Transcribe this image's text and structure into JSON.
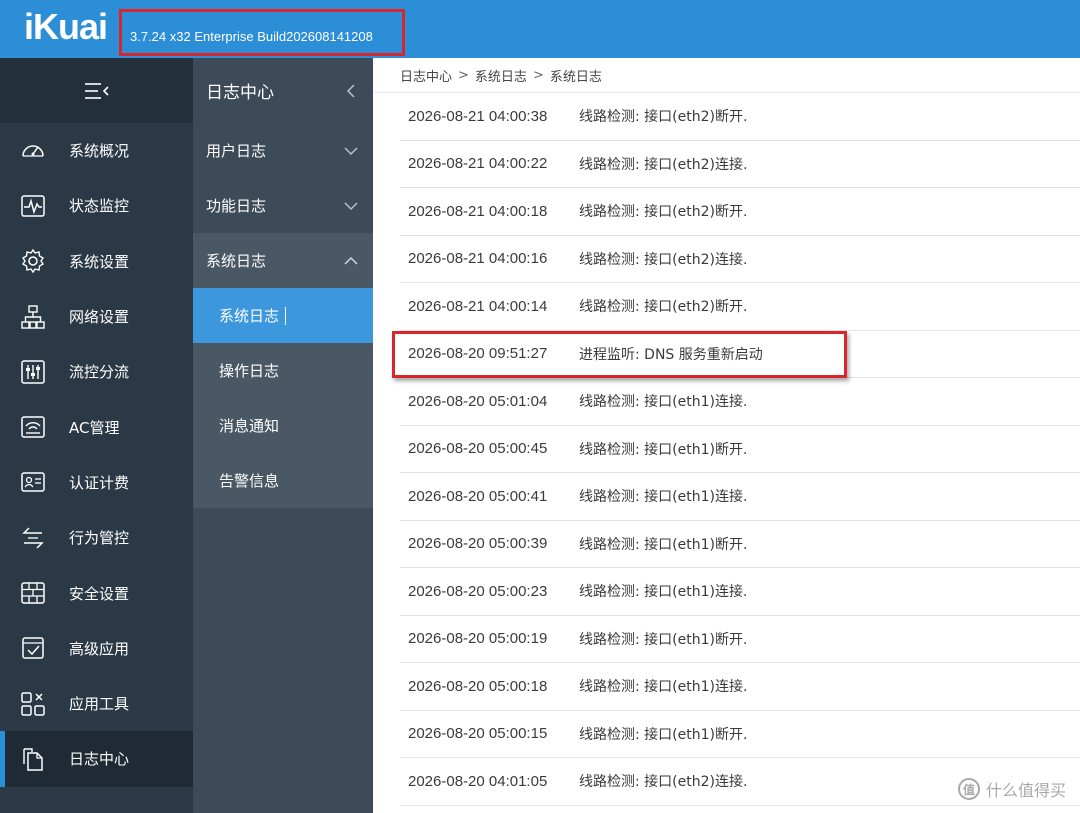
{
  "header": {
    "logo": "iKuai",
    "version": "3.7.24 x32 Enterprise Build202608141208"
  },
  "sidebar": {
    "items": [
      {
        "label": "系统概况",
        "icon": "gauge-icon"
      },
      {
        "label": "状态监控",
        "icon": "pulse-monitor-icon"
      },
      {
        "label": "系统设置",
        "icon": "gear-icon"
      },
      {
        "label": "网络设置",
        "icon": "network-tree-icon"
      },
      {
        "label": "流控分流",
        "icon": "sliders-icon"
      },
      {
        "label": "AC管理",
        "icon": "wifi-router-icon"
      },
      {
        "label": "认证计费",
        "icon": "id-card-icon"
      },
      {
        "label": "行为管控",
        "icon": "swap-arrows-icon"
      },
      {
        "label": "安全设置",
        "icon": "firewall-icon"
      },
      {
        "label": "高级应用",
        "icon": "checklist-icon"
      },
      {
        "label": "应用工具",
        "icon": "tools-grid-icon"
      },
      {
        "label": "日志中心",
        "icon": "documents-icon"
      }
    ]
  },
  "submenu": {
    "title": "日志中心",
    "groups": {
      "user_log": "用户日志",
      "function_log": "功能日志",
      "system_log": "系统日志"
    },
    "children": [
      "系统日志",
      "操作日志",
      "消息通知",
      "告警信息"
    ]
  },
  "breadcrumb": [
    "日志中心",
    "系统日志",
    "系统日志"
  ],
  "breadcrumb_sep": ">",
  "logs": [
    {
      "time": "2026-08-21 04:00:38",
      "msg": "线路检测: 接口(eth2)断开."
    },
    {
      "time": "2026-08-21 04:00:22",
      "msg": "线路检测: 接口(eth2)连接."
    },
    {
      "time": "2026-08-21 04:00:18",
      "msg": "线路检测: 接口(eth2)断开."
    },
    {
      "time": "2026-08-21 04:00:16",
      "msg": "线路检测: 接口(eth2)连接."
    },
    {
      "time": "2026-08-21 04:00:14",
      "msg": "线路检测: 接口(eth2)断开."
    },
    {
      "time": "2026-08-20 09:51:27",
      "msg": "进程监听: DNS 服务重新启动"
    },
    {
      "time": "2026-08-20 05:01:04",
      "msg": "线路检测: 接口(eth1)连接."
    },
    {
      "time": "2026-08-20 05:00:45",
      "msg": "线路检测: 接口(eth1)断开."
    },
    {
      "time": "2026-08-20 05:00:41",
      "msg": "线路检测: 接口(eth1)连接."
    },
    {
      "time": "2026-08-20 05:00:39",
      "msg": "线路检测: 接口(eth1)断开."
    },
    {
      "time": "2026-08-20 05:00:23",
      "msg": "线路检测: 接口(eth1)连接."
    },
    {
      "time": "2026-08-20 05:00:19",
      "msg": "线路检测: 接口(eth1)断开."
    },
    {
      "time": "2026-08-20 05:00:18",
      "msg": "线路检测: 接口(eth1)连接."
    },
    {
      "time": "2026-08-20 05:00:15",
      "msg": "线路检测: 接口(eth1)断开."
    },
    {
      "time": "2026-08-20 04:01:05",
      "msg": "线路检测: 接口(eth2)连接."
    }
  ],
  "watermark": {
    "symbol": "值",
    "text": "什么值得买"
  },
  "colors": {
    "header": "#2d8ed8",
    "sidebar": "#2b3845",
    "submenu": "#3d4a58",
    "active": "#3c97dc",
    "highlight": "#d9262c"
  }
}
